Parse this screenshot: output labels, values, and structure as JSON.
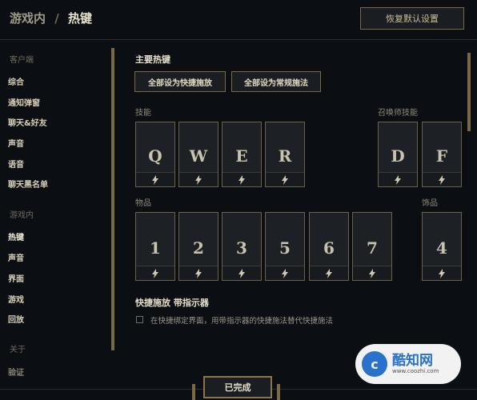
{
  "header": {
    "breadcrumb_parent": "游戏内",
    "breadcrumb_separator": "/",
    "breadcrumb_current": "热键",
    "restore_defaults_label": "恢复默认设置"
  },
  "sidebar": {
    "client_section": "客户端",
    "client_items": [
      "综合",
      "通知弹窗",
      "聊天&好友",
      "声音",
      "语音",
      "聊天黑名单"
    ],
    "ingame_section": "游戏内",
    "ingame_items": [
      "热键",
      "声音",
      "界面",
      "游戏",
      "回放"
    ],
    "about_section": "关于",
    "about_items": [
      "验证"
    ]
  },
  "main": {
    "primary_title": "主要热键",
    "quickcast_all_label": "全部设为快捷施放",
    "normalcast_all_label": "全部设为常规施法",
    "abilities_label": "技能",
    "summoner_label": "召唤师技能",
    "ability_keys": [
      "Q",
      "W",
      "E",
      "R"
    ],
    "summoner_keys": [
      "D",
      "F"
    ],
    "items_label": "物品",
    "item_keys": [
      "1",
      "2",
      "3",
      "5",
      "6",
      "7"
    ],
    "trinket_label": "饰品",
    "trinket_key": "4",
    "indicator_title": "快捷施放 带指示器",
    "indicator_checkbox_label": "在快捷绑定界面，用带指示器的快捷施法替代快捷施法",
    "indicator_checked": false
  },
  "footer": {
    "done_label": "已完成"
  },
  "watermark": {
    "logo_letter": "c",
    "brand": "酷知网",
    "url": "www.coozhi.com"
  },
  "colors": {
    "background": "#0b0f14",
    "gold_border": "#7a6a44",
    "text_light": "#e6dfc8",
    "watermark_blue": "#2a78d6"
  }
}
